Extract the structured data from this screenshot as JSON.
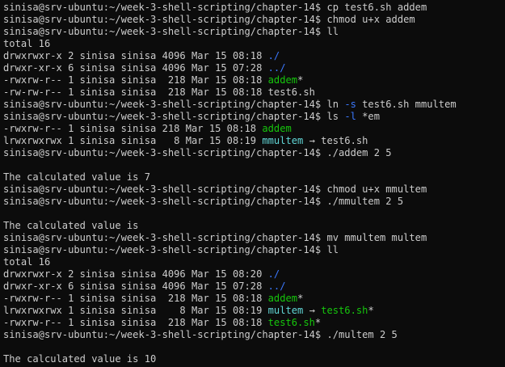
{
  "colors": {
    "background": "#0c0c0c",
    "foreground": "#cccccc",
    "directory": "#3b78ff",
    "executable": "#16c60c",
    "symlink": "#61d6d6"
  },
  "lines": [
    [
      {
        "t": "sinisa@srv-ubuntu:~/week-3-shell-scripting/chapter-14$ cp test6.sh addem"
      }
    ],
    [
      {
        "t": "sinisa@srv-ubuntu:~/week-3-shell-scripting/chapter-14$ chmod u+x addem"
      }
    ],
    [
      {
        "t": "sinisa@srv-ubuntu:~/week-3-shell-scripting/chapter-14$ ll"
      }
    ],
    [
      {
        "t": "total 16"
      }
    ],
    [
      {
        "t": "drwxrwxr-x 2 sinisa sinisa 4096 Mar 15 08:18 "
      },
      {
        "t": "./",
        "c": "dir"
      }
    ],
    [
      {
        "t": "drwxr-xr-x 6 sinisa sinisa 4096 Mar 15 07:28 "
      },
      {
        "t": "../",
        "c": "dir"
      }
    ],
    [
      {
        "t": "-rwxrw-r-- 1 sinisa sinisa  218 Mar 15 08:18 "
      },
      {
        "t": "addem",
        "c": "exe"
      },
      {
        "t": "*"
      }
    ],
    [
      {
        "t": "-rw-rw-r-- 1 sinisa sinisa  218 Mar 15 08:18 test6.sh"
      }
    ],
    [
      {
        "t": "sinisa@srv-ubuntu:~/week-3-shell-scripting/chapter-14$ ln "
      },
      {
        "t": "-s",
        "c": "opt"
      },
      {
        "t": " test6.sh mmultem"
      }
    ],
    [
      {
        "t": "sinisa@srv-ubuntu:~/week-3-shell-scripting/chapter-14$ ls "
      },
      {
        "t": "-l",
        "c": "opt"
      },
      {
        "t": " *em"
      }
    ],
    [
      {
        "t": "-rwxrw-r-- 1 sinisa sinisa 218 Mar 15 08:18 "
      },
      {
        "t": "addem",
        "c": "exe"
      }
    ],
    [
      {
        "t": "lrwxrwxrwx 1 sinisa sinisa   8 Mar 15 08:19 "
      },
      {
        "t": "mmultem",
        "c": "link"
      },
      {
        "t": " → test6.sh"
      }
    ],
    [
      {
        "t": "sinisa@srv-ubuntu:~/week-3-shell-scripting/chapter-14$ ./addem 2 5"
      }
    ],
    [
      {
        "t": ""
      }
    ],
    [
      {
        "t": "The calculated value is 7"
      }
    ],
    [
      {
        "t": "sinisa@srv-ubuntu:~/week-3-shell-scripting/chapter-14$ chmod u+x mmultem"
      }
    ],
    [
      {
        "t": "sinisa@srv-ubuntu:~/week-3-shell-scripting/chapter-14$ ./mmultem 2 5"
      }
    ],
    [
      {
        "t": ""
      }
    ],
    [
      {
        "t": "The calculated value is"
      }
    ],
    [
      {
        "t": "sinisa@srv-ubuntu:~/week-3-shell-scripting/chapter-14$ mv mmultem multem"
      }
    ],
    [
      {
        "t": "sinisa@srv-ubuntu:~/week-3-shell-scripting/chapter-14$ ll"
      }
    ],
    [
      {
        "t": "total 16"
      }
    ],
    [
      {
        "t": "drwxrwxr-x 2 sinisa sinisa 4096 Mar 15 08:20 "
      },
      {
        "t": "./",
        "c": "dir"
      }
    ],
    [
      {
        "t": "drwxr-xr-x 6 sinisa sinisa 4096 Mar 15 07:28 "
      },
      {
        "t": "../",
        "c": "dir"
      }
    ],
    [
      {
        "t": "-rwxrw-r-- 1 sinisa sinisa  218 Mar 15 08:18 "
      },
      {
        "t": "addem",
        "c": "exe"
      },
      {
        "t": "*"
      }
    ],
    [
      {
        "t": "lrwxrwxrwx 1 sinisa sinisa    8 Mar 15 08:19 "
      },
      {
        "t": "multem",
        "c": "link"
      },
      {
        "t": " → "
      },
      {
        "t": "test6.sh",
        "c": "exe"
      },
      {
        "t": "*"
      }
    ],
    [
      {
        "t": "-rwxrw-r-- 1 sinisa sinisa  218 Mar 15 08:18 "
      },
      {
        "t": "test6.sh",
        "c": "exe"
      },
      {
        "t": "*"
      }
    ],
    [
      {
        "t": "sinisa@srv-ubuntu:~/week-3-shell-scripting/chapter-14$ ./multem 2 5"
      }
    ],
    [
      {
        "t": ""
      }
    ],
    [
      {
        "t": "The calculated value is 10"
      }
    ]
  ]
}
